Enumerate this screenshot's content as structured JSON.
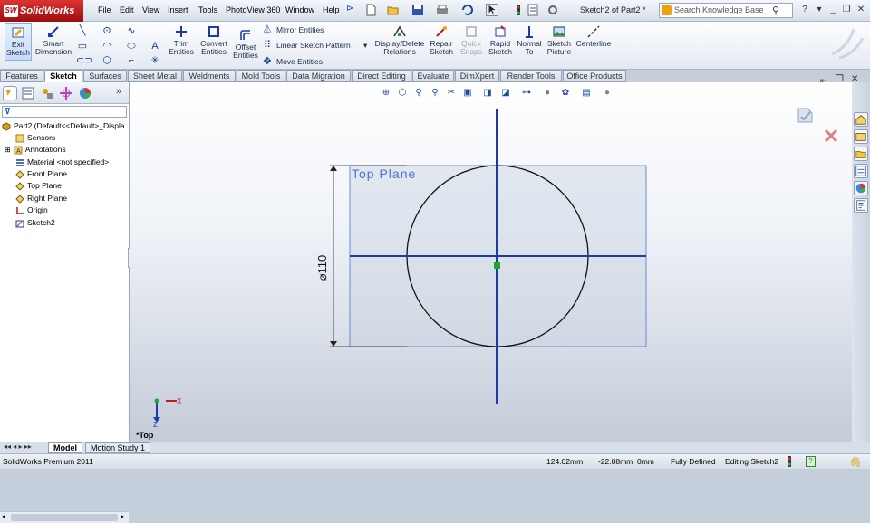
{
  "app": {
    "logo": "SolidWorks",
    "doc_title": "Sketch2 of Part2 *",
    "search_placeholder": "Search Knowledge Base"
  },
  "menu": [
    "File",
    "Edit",
    "View",
    "Insert",
    "Tools",
    "PhotoView 360",
    "Window",
    "Help"
  ],
  "command_manager": {
    "exit_sketch": "Exit Sketch",
    "smart_dimension": "Smart Dimension",
    "trim_entities": "Trim Entities",
    "convert_entities": "Convert Entities",
    "offset_entities": "Offset Entities",
    "mirror_entities": "Mirror Entities",
    "linear_sketch_pattern": "Linear Sketch Pattern",
    "move_entities": "Move Entities",
    "display_delete_relations": "Display/Delete Relations",
    "repair_sketch": "Repair Sketch",
    "quick_snaps": "Quick Snaps",
    "rapid_sketch": "Rapid Sketch",
    "normal_to": "Normal To",
    "sketch_picture": "Sketch Picture",
    "centerline": "Centerline"
  },
  "tabs": [
    "Features",
    "Sketch",
    "Surfaces",
    "Sheet Metal",
    "Weldments",
    "Mold Tools",
    "Data Migration",
    "Direct Editing",
    "Evaluate",
    "DimXpert",
    "Render Tools",
    "Office Products"
  ],
  "active_tab": "Sketch",
  "feature_tree": {
    "root": "Part2  (Default<<Default>_Displa",
    "items": [
      "Sensors",
      "Annotations",
      "Material <not specified>",
      "Front Plane",
      "Top Plane",
      "Right Plane",
      "Origin",
      "Sketch2"
    ]
  },
  "viewport": {
    "plane_label": "Top Plane",
    "dimension": "⌀110",
    "view_label": "*Top",
    "axis_x": "X",
    "axis_z": "Z"
  },
  "bottom_tabs": [
    "Model",
    "Motion Study 1"
  ],
  "status": {
    "product": "SolidWorks Premium 2011",
    "x": "124.02mm",
    "y": "-22.88mm",
    "z": "0mm",
    "definition": "Fully Defined",
    "mode": "Editing Sketch2"
  },
  "colors": {
    "accent": "#1e3fa0",
    "title_red": "#c21a1a",
    "sketch_blue": "#1c3aa8",
    "selection_green": "#1aa82a"
  }
}
